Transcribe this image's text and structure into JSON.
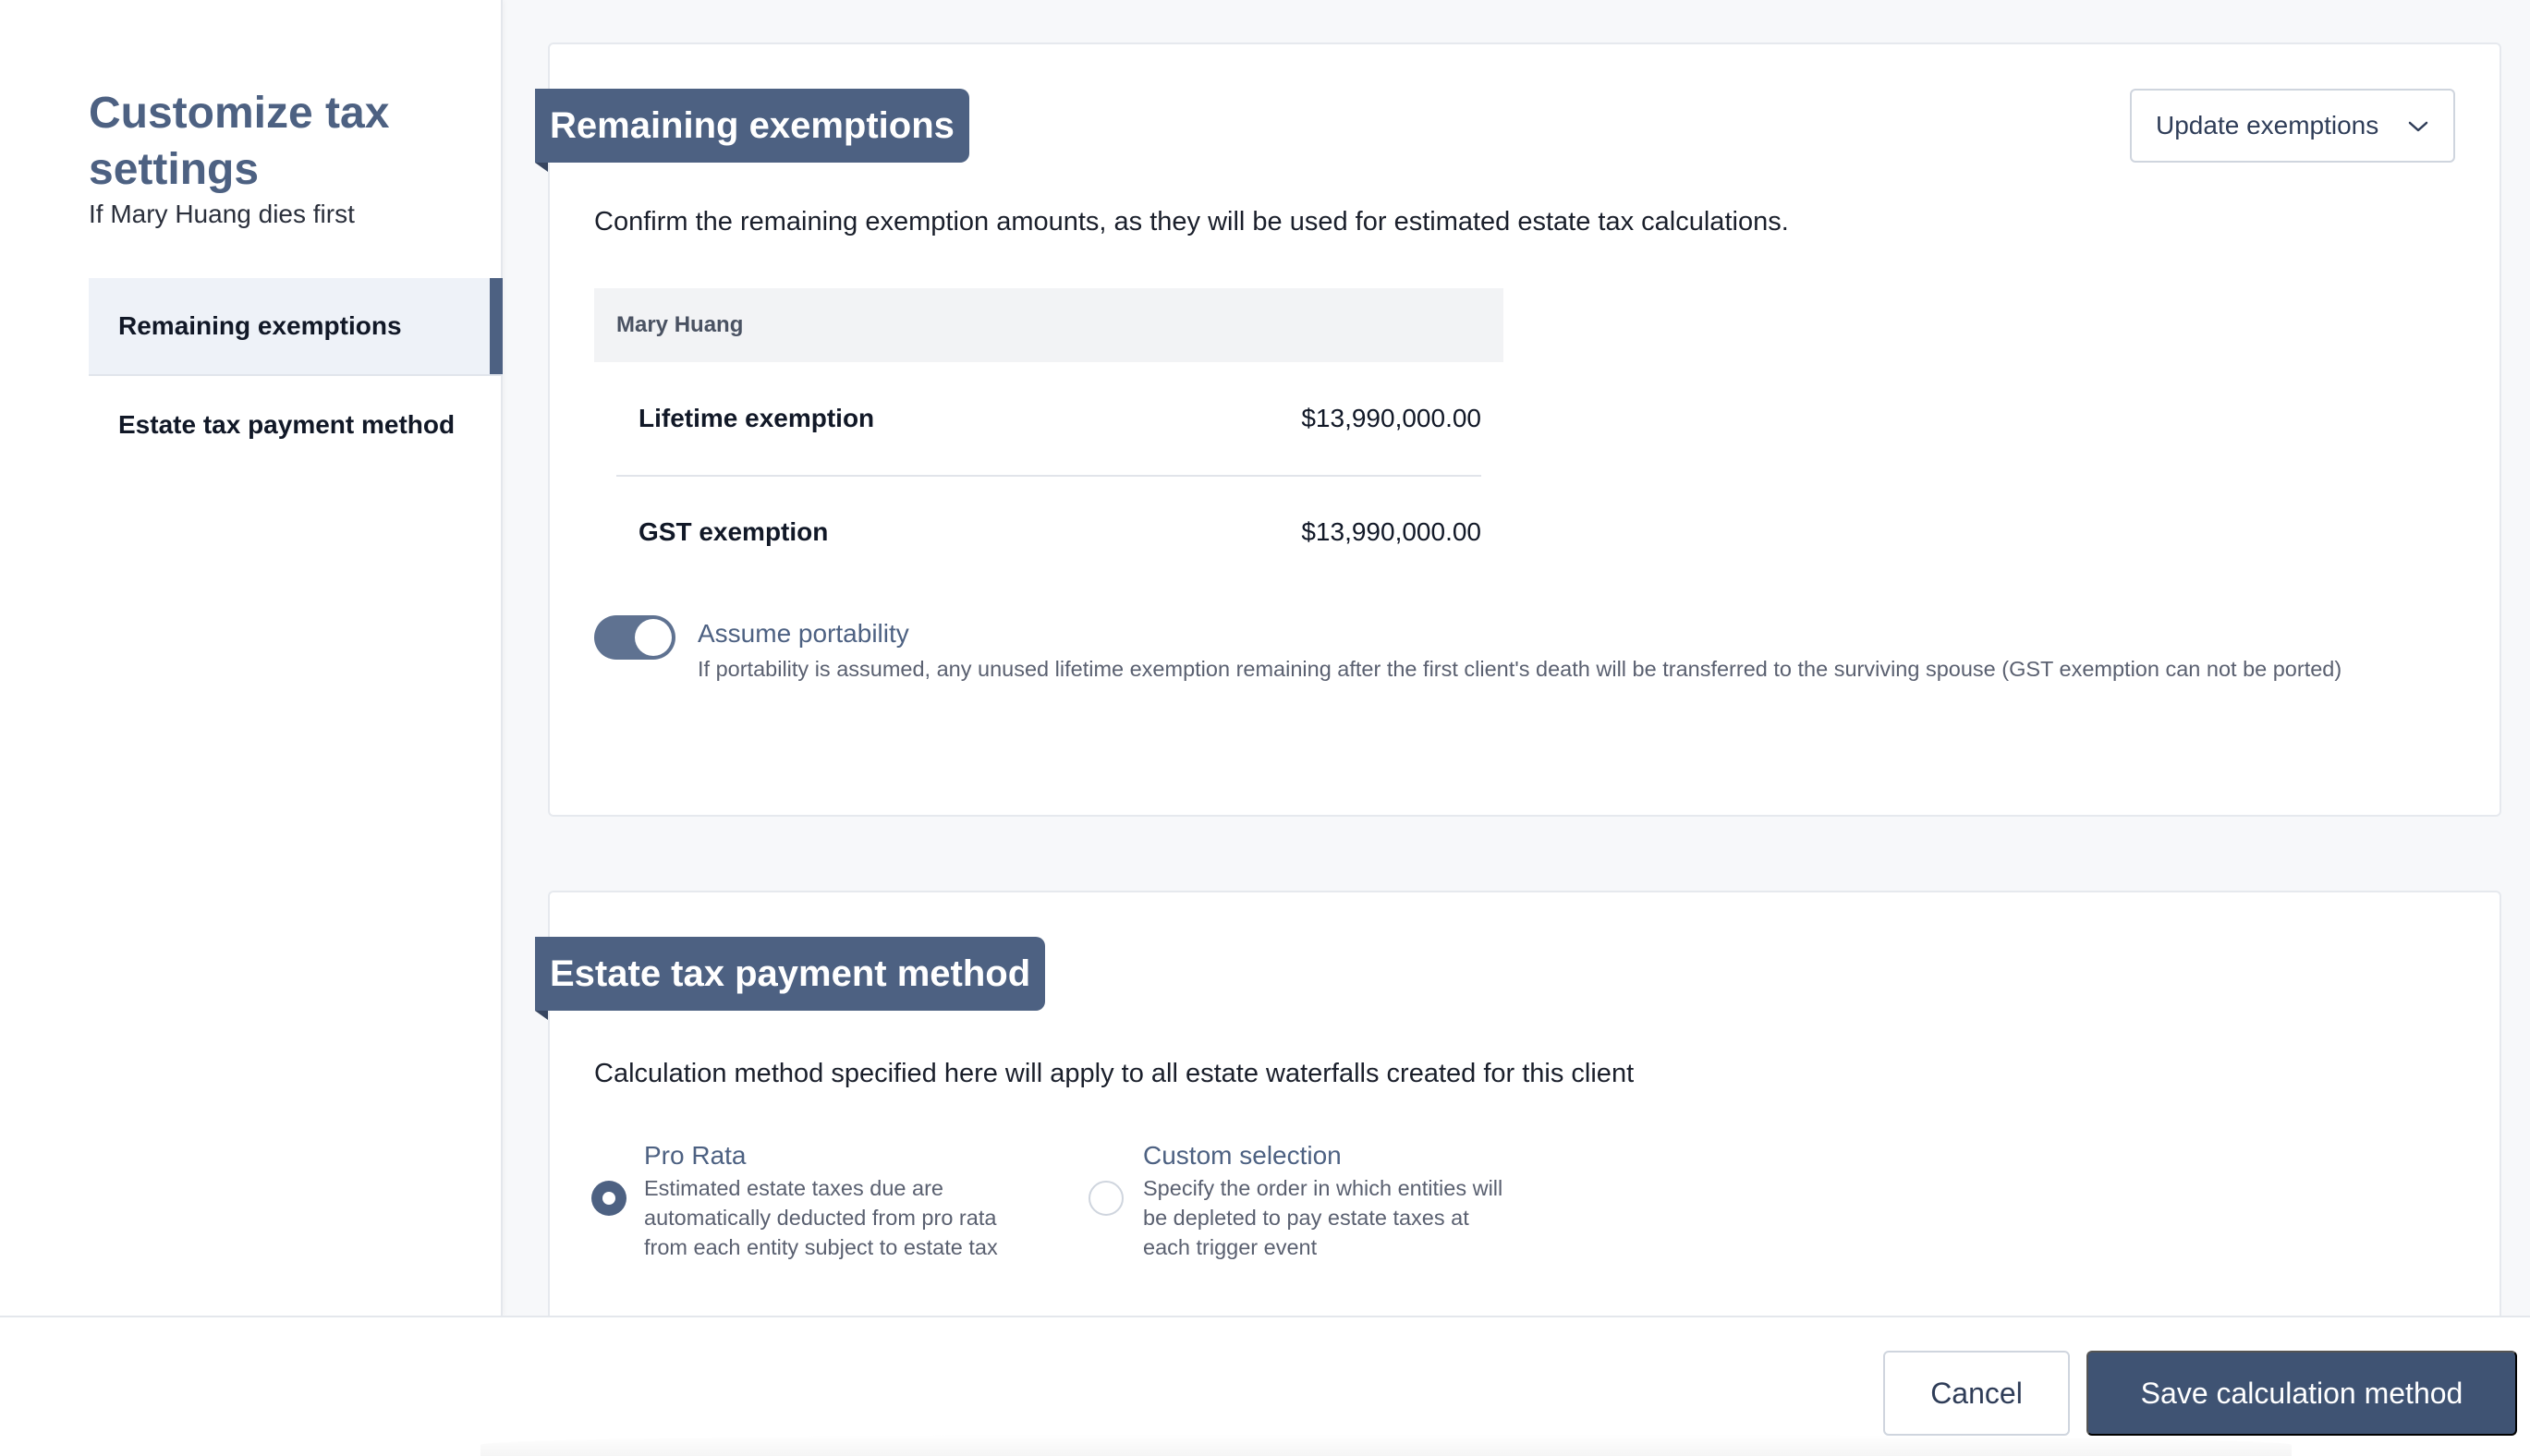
{
  "sidebar": {
    "title": "Customize tax settings",
    "subtitle": "If Mary Huang dies first",
    "items": [
      {
        "label": "Remaining exemptions",
        "active": true
      },
      {
        "label": "Estate tax payment method",
        "active": false
      }
    ]
  },
  "exemptions": {
    "heading": "Remaining exemptions",
    "update_button": "Update exemptions",
    "description": "Confirm the remaining exemption amounts, as they will be used for estimated estate tax calculations.",
    "table": {
      "person": "Mary Huang",
      "rows": [
        {
          "label": "Lifetime exemption",
          "value": "$13,990,000.00"
        },
        {
          "label": "GST exemption",
          "value": "$13,990,000.00"
        }
      ]
    },
    "portability": {
      "label": "Assume portability",
      "enabled": true,
      "help": "If portability is assumed, any unused lifetime exemption remaining after the first client's death will be transferred to the surviving spouse (GST exemption can not be ported)"
    }
  },
  "payment_method": {
    "heading": "Estate tax payment method",
    "description": "Calculation method specified here will apply to all estate waterfalls created for this client",
    "options": [
      {
        "title": "Pro Rata",
        "desc": "Estimated estate taxes due are automatically deducted from pro rata from each entity subject to estate tax",
        "selected": true
      },
      {
        "title": "Custom selection",
        "desc": "Specify the order in which entities will be depleted to pay estate taxes at each trigger event",
        "selected": false
      }
    ]
  },
  "footer": {
    "cancel_label": "Cancel",
    "save_label": "Save calculation method"
  },
  "colors": {
    "accent": "#4d6182",
    "primary_button": "#3f5373"
  }
}
